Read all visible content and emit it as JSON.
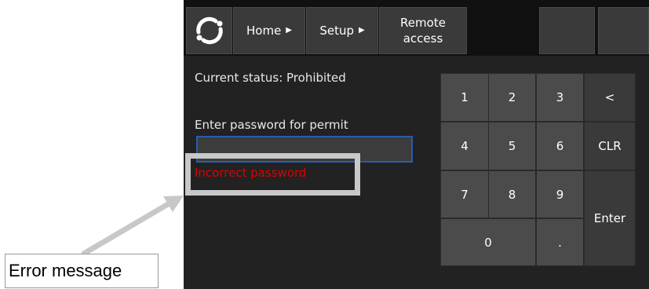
{
  "topbar": {
    "logo_icon": "cycle-logo-icon",
    "home_label": "Home",
    "setup_label": "Setup",
    "remote_line1": "Remote",
    "remote_line2": "access",
    "arrow_glyph": "▶"
  },
  "main": {
    "status_text": "Current status: Prohibited",
    "password_prompt": "Enter password for permit",
    "password_value": "",
    "error_text": "Incorrect password"
  },
  "keypad": {
    "keys": [
      "1",
      "2",
      "3",
      "<",
      "4",
      "5",
      "6",
      "CLR",
      "7",
      "8",
      "9",
      "Enter",
      "0",
      "."
    ]
  },
  "annotation": {
    "label": "Error message"
  },
  "colors": {
    "error": "#e00000",
    "field_border": "#2a5cb0",
    "highlight": "#c8c8c8"
  }
}
